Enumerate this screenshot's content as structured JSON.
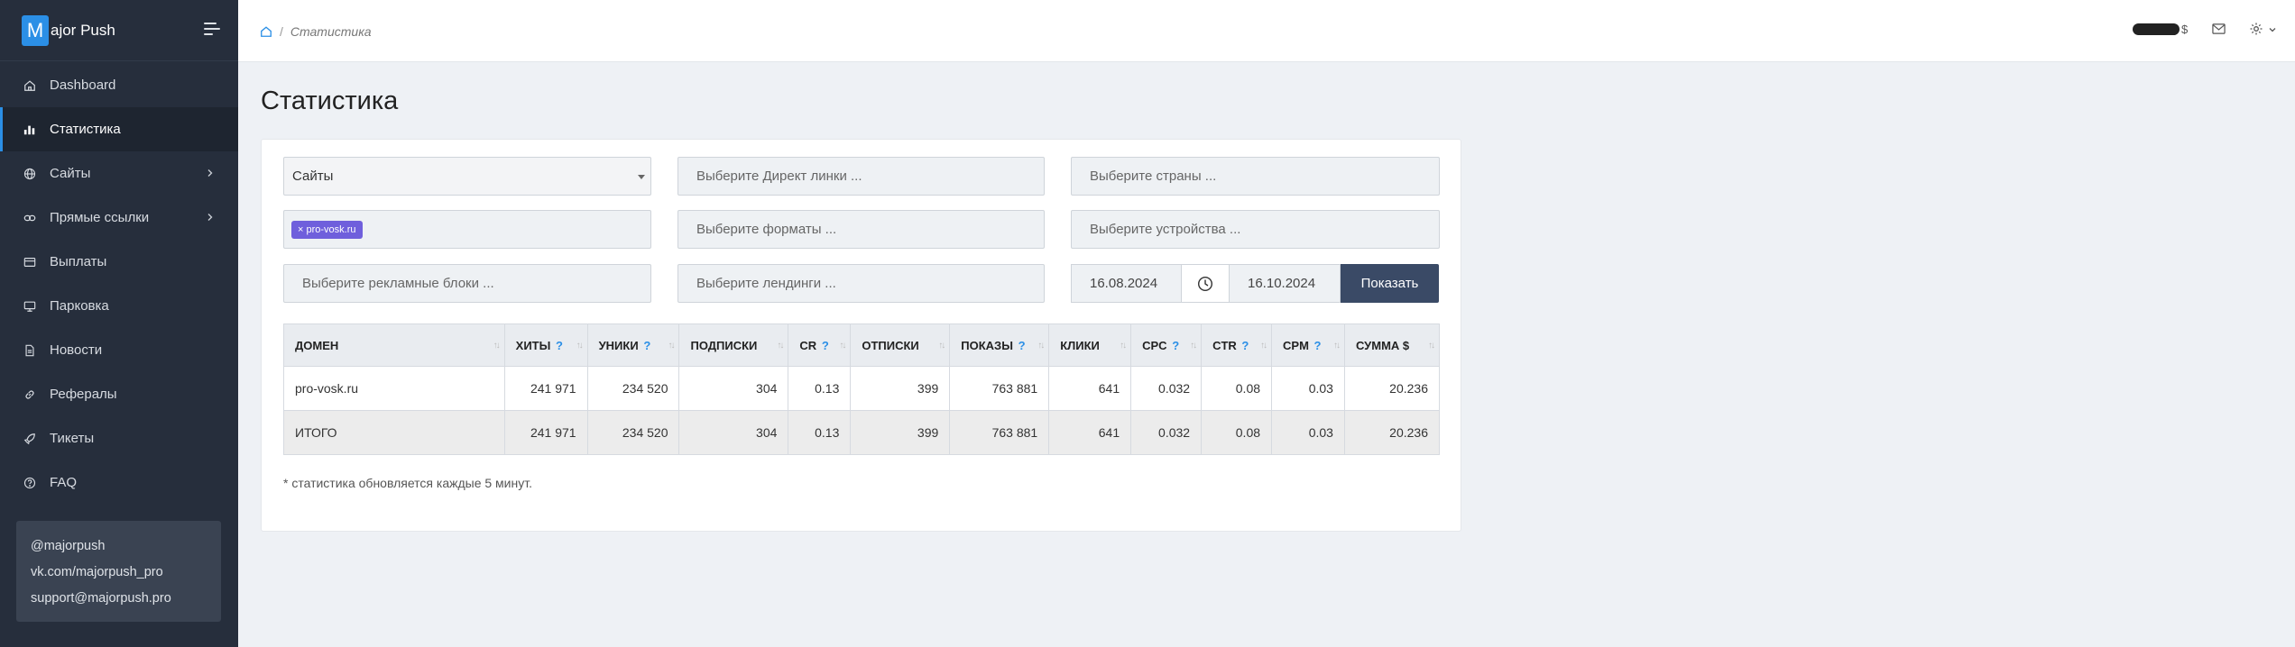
{
  "brand": {
    "mark": "M",
    "text": "ajor Push"
  },
  "sidebar": {
    "items": [
      {
        "label": "Dashboard",
        "icon": "home-icon"
      },
      {
        "label": "Статистика",
        "icon": "bar-chart-icon"
      },
      {
        "label": "Сайты",
        "icon": "globe-icon"
      },
      {
        "label": "Прямые ссылки",
        "icon": "link-icon"
      },
      {
        "label": "Выплаты",
        "icon": "wallet-icon"
      },
      {
        "label": "Парковка",
        "icon": "monitor-icon"
      },
      {
        "label": "Новости",
        "icon": "document-icon"
      },
      {
        "label": "Рефералы",
        "icon": "chain-icon"
      },
      {
        "label": "Тикеты",
        "icon": "rocket-icon"
      },
      {
        "label": "FAQ",
        "icon": "question-circle-icon"
      }
    ],
    "contacts": [
      "@majorpush",
      "vk.com/majorpush_pro",
      "support@majorpush.pro"
    ]
  },
  "topbar": {
    "breadcrumb": "Статистика",
    "balance_suffix": "$"
  },
  "page": {
    "title": "Статистика"
  },
  "filters": {
    "sites_select": "Сайты",
    "direct_links_placeholder": "Выберите Директ линки ...",
    "countries_placeholder": "Выберите страны ...",
    "selected_site_tag": "× pro-vosk.ru",
    "formats_placeholder": "Выберите форматы ...",
    "devices_placeholder": "Выберите устройства ...",
    "ad_blocks_placeholder": "Выберите рекламные блоки ...",
    "landings_placeholder": "Выберите лендинги ...",
    "date_from": "16.08.2024",
    "date_to": "16.10.2024",
    "show_button": "Показать"
  },
  "table": {
    "headers": [
      {
        "label": "ДОМЕН",
        "q": ""
      },
      {
        "label": "ХИТЫ",
        "q": "?"
      },
      {
        "label": "УНИКИ",
        "q": "?"
      },
      {
        "label": "ПОДПИСКИ",
        "q": ""
      },
      {
        "label": "CR",
        "q": "?"
      },
      {
        "label": "ОТПИСКИ",
        "q": ""
      },
      {
        "label": "ПОКАЗЫ",
        "q": "?"
      },
      {
        "label": "КЛИКИ",
        "q": ""
      },
      {
        "label": "CPC",
        "q": "?"
      },
      {
        "label": "CTR",
        "q": "?"
      },
      {
        "label": "CPM",
        "q": "?"
      },
      {
        "label": "СУММА $",
        "q": ""
      }
    ],
    "rows": [
      [
        "pro-vosk.ru",
        "241 971",
        "234 520",
        "304",
        "0.13",
        "399",
        "763 881",
        "641",
        "0.032",
        "0.08",
        "0.03",
        "20.236"
      ],
      [
        "ИТОГО",
        "241 971",
        "234 520",
        "304",
        "0.13",
        "399",
        "763 881",
        "641",
        "0.032",
        "0.08",
        "0.03",
        "20.236"
      ]
    ]
  },
  "note": "* статистика обновляется каждые 5 минут."
}
